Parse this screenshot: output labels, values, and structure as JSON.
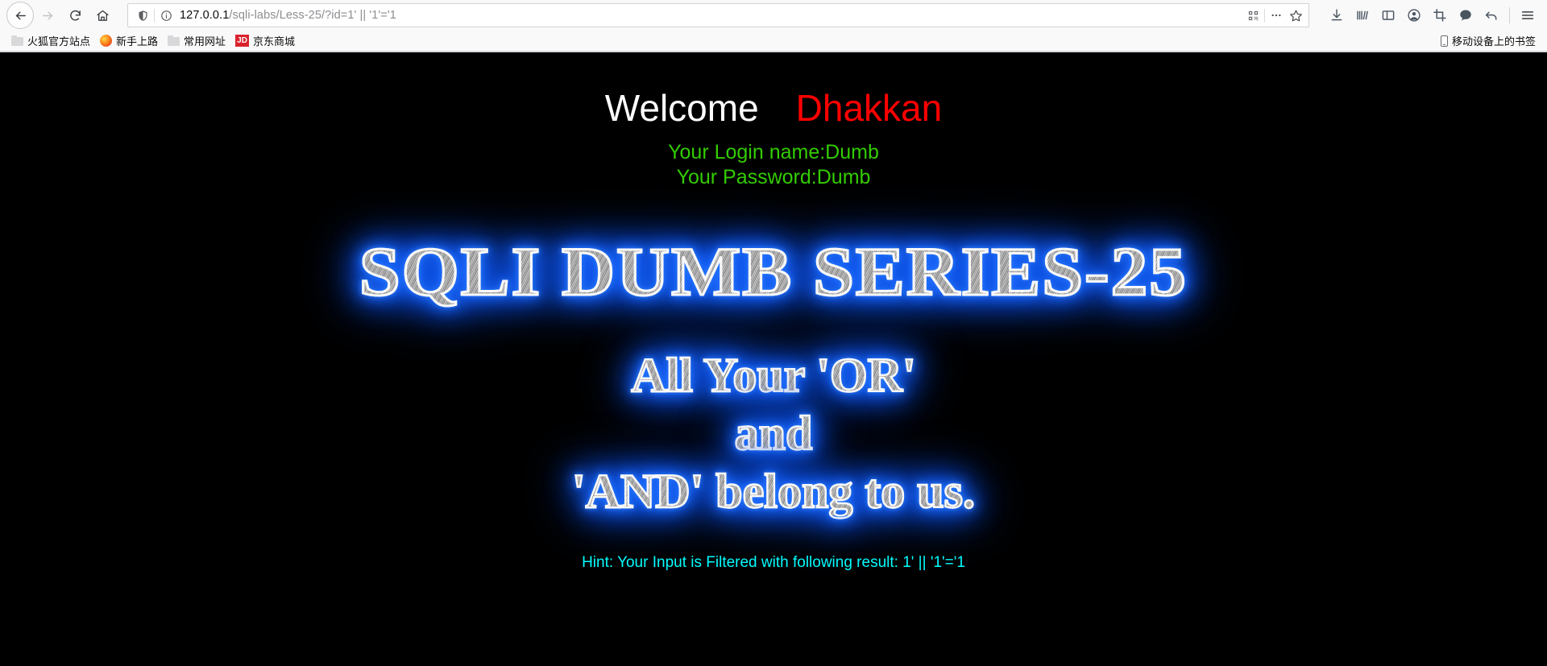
{
  "browser": {
    "nav": {
      "back_label": "Back",
      "forward_label": "Forward",
      "reload_label": "Reload",
      "home_label": "Home"
    },
    "urlbar": {
      "host": "127.0.0.1",
      "path": "/sqli-labs/Less-25/?id=1' || '1'='1",
      "full_url": "127.0.0.1/sqli-labs/Less-25/?id=1' || '1'='1",
      "shield_icon": "shield-icon",
      "info_icon": "info-circle-icon",
      "qr_icon": "qr-code-icon",
      "more_icon": "ellipsis-icon",
      "bookmark_icon": "star-icon"
    },
    "toolbar_right": [
      {
        "name": "downloads-icon",
        "label": "Downloads"
      },
      {
        "name": "library-icon",
        "label": "Library"
      },
      {
        "name": "sidebar-icon",
        "label": "Sidebar"
      },
      {
        "name": "account-icon",
        "label": "Account"
      },
      {
        "name": "screenshot-icon",
        "label": "Screenshot"
      },
      {
        "name": "pocket-icon",
        "label": "Pocket"
      },
      {
        "name": "undo-icon",
        "label": "Undo close tab"
      },
      {
        "name": "menu-icon",
        "label": "Open menu"
      }
    ],
    "bookmarks": [
      {
        "label": "火狐官方站点",
        "icon": "folder-icon"
      },
      {
        "label": "新手上路",
        "icon": "firefox-icon"
      },
      {
        "label": "常用网址",
        "icon": "folder-icon"
      },
      {
        "label": "京东商城",
        "icon": "jd-icon"
      }
    ],
    "bookmarks_right": {
      "label": "移动设备上的书签",
      "icon": "mobile-phone-icon"
    }
  },
  "page": {
    "welcome_text": "Welcome",
    "user_name": "Dhakkan",
    "login_line": "Your Login name:Dumb",
    "password_line": "Your Password:Dumb",
    "title": "SQLI DUMB SERIES-25",
    "slogan_1": "All Your 'OR'",
    "slogan_2": "and",
    "slogan_3": "'AND' belong to us.",
    "hint": "Hint: Your Input is Filtered with following result: 1' || '1'='1"
  },
  "colors": {
    "page_background": "#000000",
    "welcome": "#ffffff",
    "user_name": "#ff0000",
    "credentials": "#33cc00",
    "hint": "#00ffff",
    "metal_glow": "#1f6dff",
    "chrome_background": "#f9f9fa"
  }
}
